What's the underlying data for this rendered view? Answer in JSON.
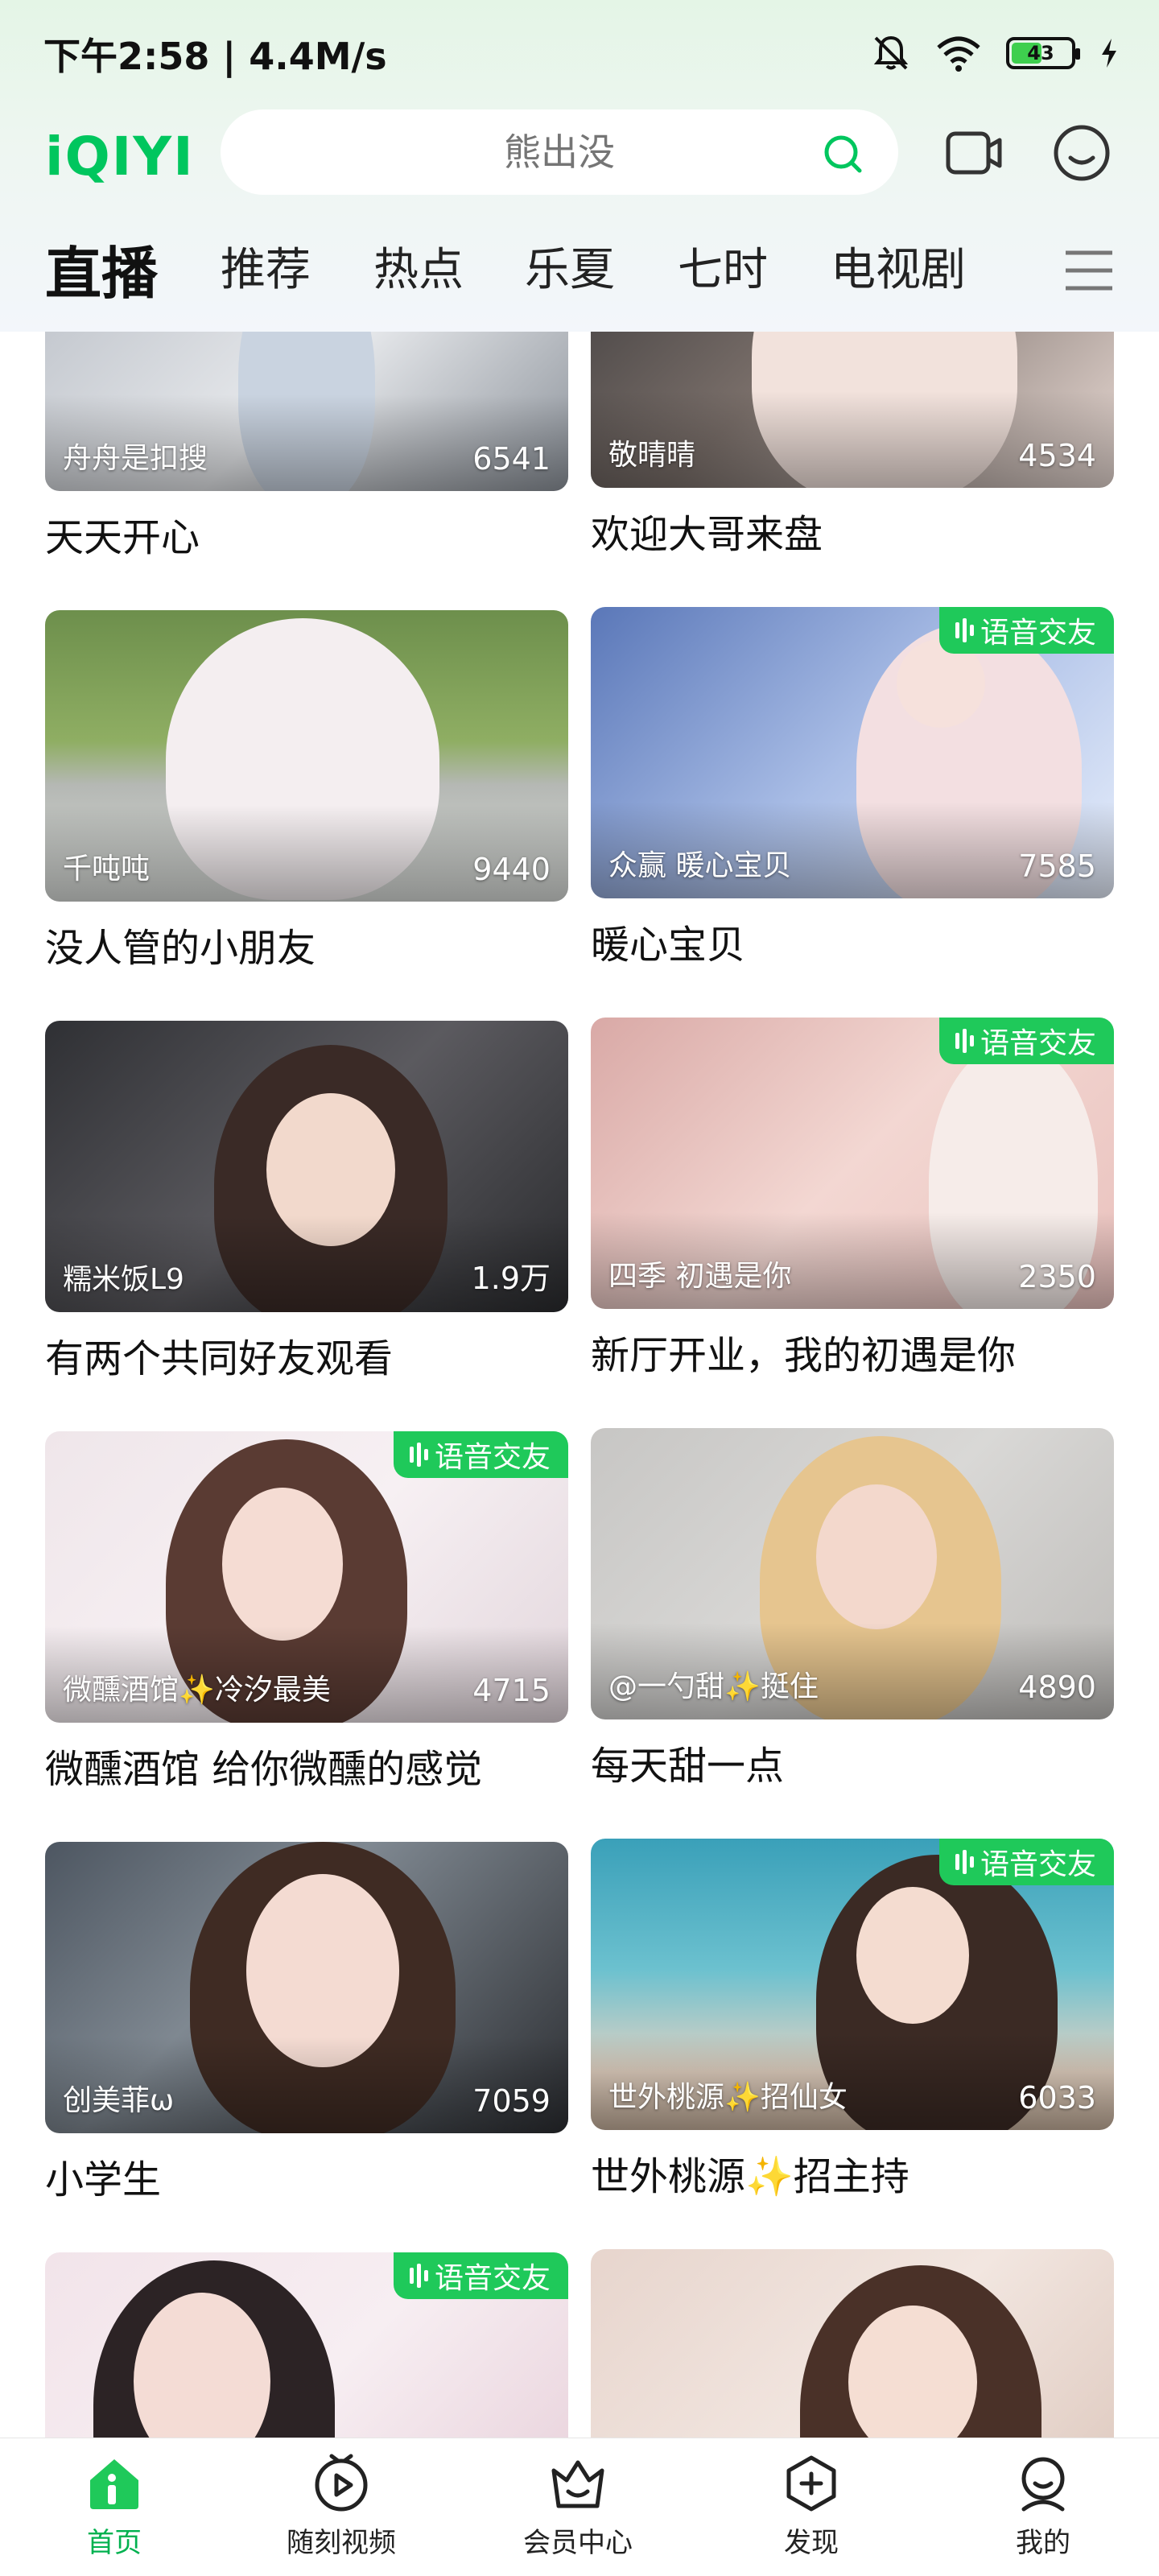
{
  "status_bar": {
    "time": "下午2:58 | 4.4M/s",
    "battery": "43"
  },
  "header": {
    "logo": "iQIYI",
    "search_placeholder": "熊出没"
  },
  "tabs": [
    {
      "label": "直播",
      "active": true
    },
    {
      "label": "推荐"
    },
    {
      "label": "热点"
    },
    {
      "label": "乐夏"
    },
    {
      "label": "七时"
    },
    {
      "label": "电视剧"
    }
  ],
  "badge_label": "语音交友",
  "cards": [
    {
      "streamer": "舟舟是扣搜",
      "viewers": "6541",
      "title": "天天开心",
      "voice": false
    },
    {
      "streamer": "敬晴晴",
      "viewers": "4534",
      "title": "欢迎大哥来盘",
      "voice": false
    },
    {
      "streamer": "千吨吨",
      "viewers": "9440",
      "title": "没人管的小朋友",
      "voice": false
    },
    {
      "streamer": "众赢  暖心宝贝",
      "viewers": "7585",
      "title": "暖心宝贝",
      "voice": true
    },
    {
      "streamer": "糯米饭L9",
      "viewers": "1.9万",
      "title": "有两个共同好友观看",
      "voice": false
    },
    {
      "streamer": "四季 初遇是你",
      "viewers": "2350",
      "title": "新厅开业，我的初遇是你",
      "voice": true
    },
    {
      "streamer": "微醺酒馆✨冷汐最美",
      "viewers": "4715",
      "title": "微醺酒馆 给你微醺的感觉",
      "voice": true
    },
    {
      "streamer": "@一勺甜✨挺住",
      "viewers": "4890",
      "title": "每天甜一点",
      "voice": false
    },
    {
      "streamer": "创美菲ω",
      "viewers": "7059",
      "title": "小学生",
      "voice": false
    },
    {
      "streamer": "世外桃源✨招仙女",
      "viewers": "6033",
      "title": "世外桃源✨招主持",
      "voice": true
    },
    {
      "streamer": "",
      "viewers": "",
      "title": "",
      "voice": true
    },
    {
      "streamer": "",
      "viewers": "",
      "title": "",
      "voice": false
    }
  ],
  "bottom_nav": [
    {
      "label": "首页",
      "icon": "home-icon",
      "active": true
    },
    {
      "label": "随刻视频",
      "icon": "play-circle-icon"
    },
    {
      "label": "会员中心",
      "icon": "crown-icon"
    },
    {
      "label": "发现",
      "icon": "plus-hexagon-icon"
    },
    {
      "label": "我的",
      "icon": "profile-icon"
    }
  ],
  "colors": {
    "brand": "#00c65e",
    "badge": "#1fc95a",
    "active_nav": "#00b14f"
  }
}
